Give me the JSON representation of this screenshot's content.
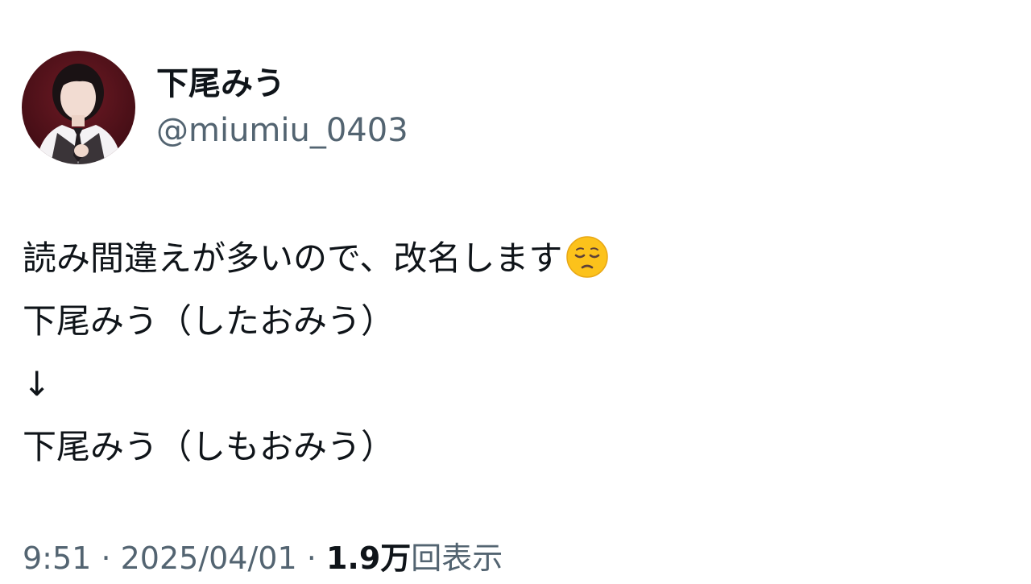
{
  "author": {
    "display_name": "下尾みう",
    "handle": "@miumiu_0403",
    "avatar_icon": "profile-photo"
  },
  "tweet": {
    "lines": [
      "読み間違えが多いので、改名します",
      "下尾みう（したおみう）",
      "↓",
      "下尾みう（しもおみう）"
    ],
    "emoji": "pensive-face-emoji"
  },
  "meta": {
    "time": "9:51",
    "separator": "·",
    "date": "2025/04/01",
    "views_count": "1.9万",
    "views_label": "回表示"
  },
  "colors": {
    "text": "#0f1419",
    "secondary": "#536471",
    "background": "#ffffff"
  }
}
